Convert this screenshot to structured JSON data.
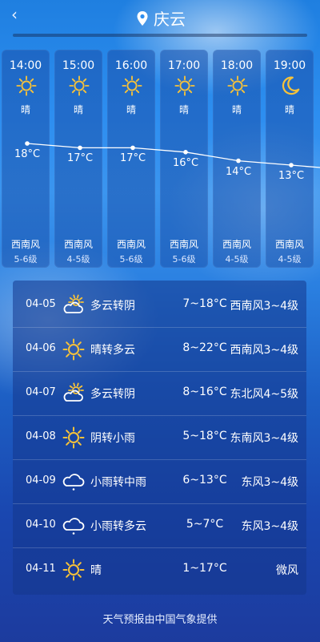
{
  "header": {
    "back_icon": "‹",
    "city": "庆云"
  },
  "hourly": [
    {
      "time": "14:00",
      "icon": "sun-icon",
      "cond": "晴",
      "temp": "18°C",
      "wind": "西南风",
      "level": "5-6级"
    },
    {
      "time": "15:00",
      "icon": "sun-icon",
      "cond": "晴",
      "temp": "17°C",
      "wind": "西南风",
      "level": "4-5级"
    },
    {
      "time": "16:00",
      "icon": "sun-icon",
      "cond": "晴",
      "temp": "17°C",
      "wind": "西南风",
      "level": "5-6级"
    },
    {
      "time": "17:00",
      "icon": "sun-icon",
      "cond": "晴",
      "temp": "16°C",
      "wind": "西南风",
      "level": "5-6级"
    },
    {
      "time": "18:00",
      "icon": "sun-icon",
      "cond": "晴",
      "temp": "14°C",
      "wind": "西南风",
      "level": "4-5级"
    },
    {
      "time": "19:00",
      "icon": "moon-icon",
      "cond": "晴",
      "temp": "13°C",
      "wind": "西南风",
      "level": "4-5级"
    }
  ],
  "daily": [
    {
      "date": "04-05",
      "icon": "partly-cloudy-icon",
      "cond": "多云转阴",
      "temp": "7~18°C",
      "wind": "西南风3~4级"
    },
    {
      "date": "04-06",
      "icon": "sun-icon",
      "cond": "晴转多云",
      "temp": "8~22°C",
      "wind": "西南风3~4级"
    },
    {
      "date": "04-07",
      "icon": "partly-cloudy-icon",
      "cond": "多云转阴",
      "temp": "8~16°C",
      "wind": "东北风4~5级"
    },
    {
      "date": "04-08",
      "icon": "sun-icon",
      "cond": "阴转小雨",
      "temp": "5~18°C",
      "wind": "东南风3~4级"
    },
    {
      "date": "04-09",
      "icon": "rain-cloud-icon",
      "cond": "小雨转中雨",
      "temp": "6~13°C",
      "wind": "东风3~4级"
    },
    {
      "date": "04-10",
      "icon": "rain-cloud-icon",
      "cond": "小雨转多云",
      "temp": "5~7°C",
      "wind": "东风3~4级"
    },
    {
      "date": "04-11",
      "icon": "sun-icon",
      "cond": "晴",
      "temp": "1~17°C",
      "wind": "微风"
    }
  ],
  "footer": "天气预报由中国气象提供",
  "colors": {
    "sun": "#f6c23a",
    "moon": "#f6c23a",
    "line": "#ffffff"
  }
}
